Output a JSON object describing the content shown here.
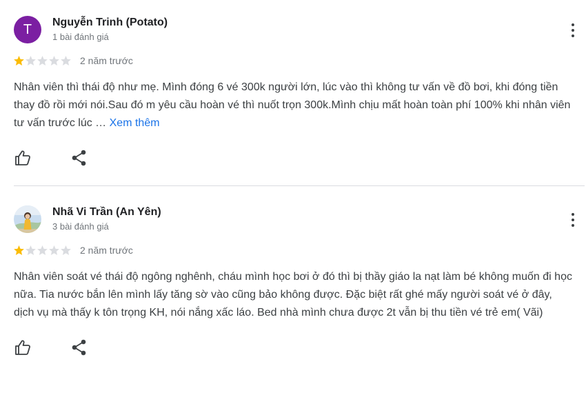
{
  "reviews": [
    {
      "author": "Nguyễn Trinh (Potato)",
      "avatar_letter": "T",
      "avatar_color": "#7b1fa2",
      "review_count": "1 bài đánh giá",
      "rating": 1,
      "rating_max": 5,
      "time": "2 năm trước",
      "text": "Nhân viên thì thái độ như mẹ. Mình đóng 6 vé 300k người lớn, lúc vào thì không tư vấn về đồ bơi, khi đóng tiền thay đồ rồi mới nói.Sau đó m yêu cầu hoàn vé thì nuốt trọn 300k.Mình chịu mất hoàn toàn phí 100% khi nhân viên tư vấn trước lúc …",
      "more_label": "Xem thêm",
      "actions": {
        "like_icon": "thumb-up-icon",
        "share_icon": "share-icon"
      }
    },
    {
      "author": "Nhã Vi Trần (An Yên)",
      "avatar_kind": "photo",
      "review_count": "3 bài đánh giá",
      "rating": 1,
      "rating_max": 5,
      "time": "2 năm trước",
      "text": "Nhân viên soát vé thái độ ngông nghênh, cháu mình học bơi ở đó thì bị thầy giáo la nạt làm bé không muốn đi học nữa. Tia nước bắn lên mình lấy tăng sờ vào cũng bảo không được. Đặc biệt rất ghé mấy người soát vé ở đây, dịch vụ mà thấy k tôn trọng KH, nói nắng xấc láo. Bed nhà mình chưa được 2t vẫn bị thu tiền vé trẻ em( Vãi)",
      "actions": {
        "like_icon": "thumb-up-icon",
        "share_icon": "share-icon"
      }
    }
  ],
  "colors": {
    "star_filled": "#fbbc04",
    "star_empty": "#dadce0",
    "link": "#1a73e8",
    "divider": "#dadce0"
  }
}
